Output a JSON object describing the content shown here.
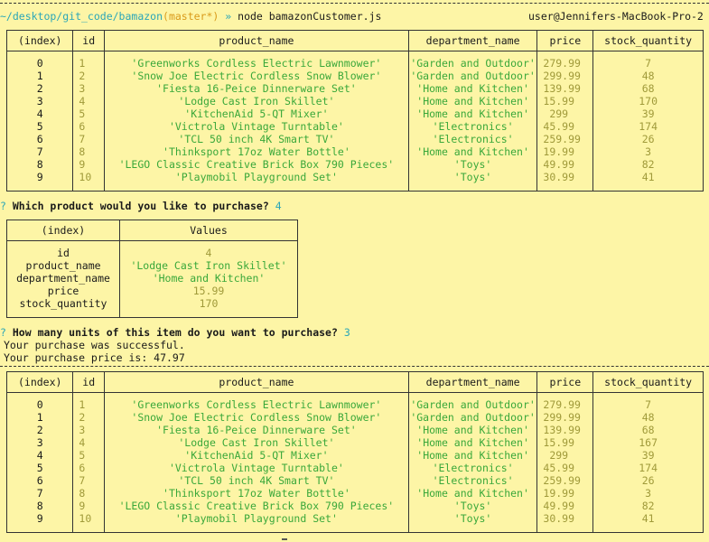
{
  "prompt": {
    "path": "~/desktop/git_code/bamazon",
    "branch": "(master*)",
    "arrow": "»",
    "command": "node bamazonCustomer.js",
    "host": "user@Jennifers-MacBook-Pro-2"
  },
  "inventory_headers": [
    "(index)",
    "id",
    "product_name",
    "department_name",
    "price",
    "stock_quantity"
  ],
  "inventory_before": [
    {
      "index": "0",
      "id": "1",
      "name": "'Greenworks Cordless Electric Lawnmower'",
      "dept": "'Garden and Outdoor'",
      "price": "279.99",
      "stock": "7"
    },
    {
      "index": "1",
      "id": "2",
      "name": "'Snow Joe Electric Cordless Snow Blower'",
      "dept": "'Garden and Outdoor'",
      "price": "299.99",
      "stock": "48"
    },
    {
      "index": "2",
      "id": "3",
      "name": "'Fiesta 16-Peice Dinnerware Set'",
      "dept": "'Home and Kitchen'",
      "price": "139.99",
      "stock": "68"
    },
    {
      "index": "3",
      "id": "4",
      "name": "'Lodge Cast Iron Skillet'",
      "dept": "'Home and Kitchen'",
      "price": "15.99",
      "stock": "170"
    },
    {
      "index": "4",
      "id": "5",
      "name": "'KitchenAid 5-QT Mixer'",
      "dept": "'Home and Kitchen'",
      "price": " 299",
      "stock": "39"
    },
    {
      "index": "5",
      "id": "6",
      "name": "'Victrola Vintage Turntable'",
      "dept": "'Electronics'",
      "price": "45.99",
      "stock": "174"
    },
    {
      "index": "6",
      "id": "7",
      "name": "'TCL 50 inch 4K Smart TV'",
      "dept": "'Electronics'",
      "price": "259.99",
      "stock": "26"
    },
    {
      "index": "7",
      "id": "8",
      "name": "'Thinksport 17oz Water Bottle'",
      "dept": "'Home and Kitchen'",
      "price": "19.99",
      "stock": "3"
    },
    {
      "index": "8",
      "id": "9",
      "name": "'LEGO Classic Creative Brick Box 790 Pieces'",
      "dept": "'Toys'",
      "price": "49.99",
      "stock": "82"
    },
    {
      "index": "9",
      "id": "10",
      "name": "'Playmobil Playground Set'",
      "dept": "'Toys'",
      "price": "30.99",
      "stock": "41"
    }
  ],
  "question1": {
    "mark": "?",
    "text": "Which product would you like to purchase?",
    "answer": "4"
  },
  "detail_headers": [
    "(index)",
    "Values"
  ],
  "detail": [
    {
      "key": "id",
      "value": "4"
    },
    {
      "key": "product_name",
      "value": "'Lodge Cast Iron Skillet'"
    },
    {
      "key": "department_name",
      "value": "'Home and Kitchen'"
    },
    {
      "key": "price",
      "value": "15.99"
    },
    {
      "key": "stock_quantity",
      "value": "170"
    }
  ],
  "question2": {
    "mark": "?",
    "text": "How many units of this item do you want to purchase?",
    "answer": "3"
  },
  "result": {
    "success": "Your purchase was successful.",
    "price": "Your purchase price is: 47.97"
  },
  "inventory_after": [
    {
      "index": "0",
      "id": "1",
      "name": "'Greenworks Cordless Electric Lawnmower'",
      "dept": "'Garden and Outdoor'",
      "price": "279.99",
      "stock": "7"
    },
    {
      "index": "1",
      "id": "2",
      "name": "'Snow Joe Electric Cordless Snow Blower'",
      "dept": "'Garden and Outdoor'",
      "price": "299.99",
      "stock": "48"
    },
    {
      "index": "2",
      "id": "3",
      "name": "'Fiesta 16-Peice Dinnerware Set'",
      "dept": "'Home and Kitchen'",
      "price": "139.99",
      "stock": "68"
    },
    {
      "index": "3",
      "id": "4",
      "name": "'Lodge Cast Iron Skillet'",
      "dept": "'Home and Kitchen'",
      "price": "15.99",
      "stock": "167"
    },
    {
      "index": "4",
      "id": "5",
      "name": "'KitchenAid 5-QT Mixer'",
      "dept": "'Home and Kitchen'",
      "price": " 299",
      "stock": "39"
    },
    {
      "index": "5",
      "id": "6",
      "name": "'Victrola Vintage Turntable'",
      "dept": "'Electronics'",
      "price": "45.99",
      "stock": "174"
    },
    {
      "index": "6",
      "id": "7",
      "name": "'TCL 50 inch 4K Smart TV'",
      "dept": "'Electronics'",
      "price": "259.99",
      "stock": "26"
    },
    {
      "index": "7",
      "id": "8",
      "name": "'Thinksport 17oz Water Bottle'",
      "dept": "'Home and Kitchen'",
      "price": "19.99",
      "stock": "3"
    },
    {
      "index": "8",
      "id": "9",
      "name": "'LEGO Classic Creative Brick Box 790 Pieces'",
      "dept": "'Toys'",
      "price": "49.99",
      "stock": "82"
    },
    {
      "index": "9",
      "id": "10",
      "name": "'Playmobil Playground Set'",
      "dept": "'Toys'",
      "price": "30.99",
      "stock": "41"
    }
  ],
  "colors": {
    "background": "#fdf5a6",
    "path": "#2aa6b8",
    "branch": "#d99a1a",
    "string": "#3aa83a",
    "number": "#a09a3a"
  }
}
